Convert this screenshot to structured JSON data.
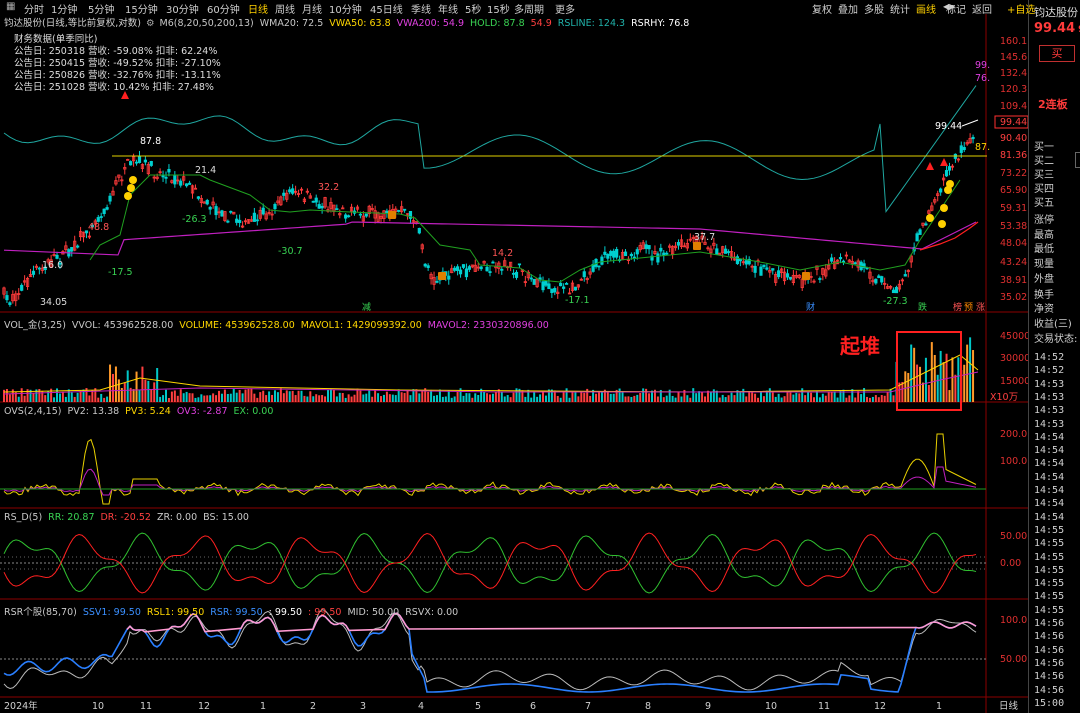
{
  "toolbar": {
    "periods": [
      "分时",
      "1分钟",
      "5分钟",
      "15分钟",
      "30分钟",
      "60分钟",
      "日线",
      "周线",
      "月线",
      "10分钟",
      "45日线",
      "季线",
      "年线",
      "5秒",
      "15秒",
      "多周期",
      "更多"
    ],
    "active_period": "日线",
    "right_buttons": [
      "复权",
      "叠加",
      "多股",
      "统计",
      "画线",
      "标记",
      "返回"
    ],
    "active_right": "画线"
  },
  "main": {
    "stock_title": "钧达股份(日线,等比前复权,对数)",
    "legend": [
      {
        "text": "M6(8,20,50,200,13)",
        "color": "#c8c8c8"
      },
      {
        "text": "WMA20: 72.5",
        "color": "#c8c8c8"
      },
      {
        "text": "VWA50: 63.8",
        "color": "#ffd700"
      },
      {
        "text": "VWA200: 54.9",
        "color": "#e040e0"
      },
      {
        "text": "HOLD: 87.8",
        "color": "#39d353"
      },
      {
        "text": "54.9",
        "color": "#ff4040"
      },
      {
        "text": "RSLINE: 124.3",
        "color": "#20b2aa"
      },
      {
        "text": "RSRHY: 76.8",
        "color": "#ffffff"
      }
    ],
    "finance_title": "财务数据(单季同比)",
    "finance_rows": [
      "公告日: 250318  营收: -59.08%  扣非: 62.24%",
      "公告日: 250415  营收: -49.52%  扣非: -27.10%",
      "公告日: 250826  营收: -32.76%  扣非: -13.11%",
      "公告日: 251028  营收: 10.42%  扣非: 27.48%"
    ],
    "price_labels": [
      "87.8",
      "21.4",
      "-26.3",
      "32.2",
      "-30.7",
      "48.8",
      "16.0",
      "-17.5",
      "34.05",
      "14.2",
      "-17.1",
      "37.7",
      "-27.3",
      "99.44",
      "87.",
      "99.",
      "76."
    ],
    "axis": [
      "160.1",
      "145.6",
      "132.4",
      "120.3",
      "109.4",
      "99.44",
      "90.40",
      "81.36",
      "73.22",
      "65.90",
      "59.31",
      "53.38",
      "48.04",
      "43.24",
      "38.91",
      "35.02"
    ],
    "markers": [
      "减",
      "财",
      "跌",
      "榜",
      "预",
      "涨"
    ]
  },
  "volume": {
    "legend": [
      {
        "text": "VOL_金(3,25)",
        "color": "#c8c8c8"
      },
      {
        "text": "VVOL: 453962528.00",
        "color": "#c8c8c8"
      },
      {
        "text": "VOLUME: 453962528.00",
        "color": "#ffd700"
      },
      {
        "text": "MAVOL1: 1429099392.00",
        "color": "#ffd700"
      },
      {
        "text": "MAVOL2: 2330320896.00",
        "color": "#e040e0"
      }
    ],
    "annotation": "起堆",
    "axis": [
      "45000",
      "30000",
      "15000"
    ],
    "unit": "X10万"
  },
  "ovs": {
    "legend": [
      {
        "text": "OVS(2,4,15)",
        "color": "#c8c8c8"
      },
      {
        "text": "PV2: 13.38",
        "color": "#c8c8c8"
      },
      {
        "text": "PV3: 5.24",
        "color": "#ffd700"
      },
      {
        "text": "OV3: -2.87",
        "color": "#e040e0"
      },
      {
        "text": "EX: 0.00",
        "color": "#39d353"
      }
    ],
    "axis": [
      "200.0",
      "100.0"
    ]
  },
  "rsd": {
    "legend": [
      {
        "text": "RS_D(5)",
        "color": "#c8c8c8"
      },
      {
        "text": "RR: 20.87",
        "color": "#39d353"
      },
      {
        "text": "DR: -20.52",
        "color": "#ff4040"
      },
      {
        "text": "ZR: 0.00",
        "color": "#c8c8c8"
      },
      {
        "text": "BS: 15.00",
        "color": "#c8c8c8"
      }
    ],
    "axis": [
      "50.00",
      "0.00"
    ]
  },
  "rsr": {
    "legend": [
      {
        "text": "RSR个股(85,70)",
        "color": "#c8c8c8"
      },
      {
        "text": "SSV1: 99.50",
        "color": "#3a8fff"
      },
      {
        "text": "RSL1: 99.50",
        "color": "#ffd700"
      },
      {
        "text": "RSR: 99.50",
        "color": "#3a8fff"
      },
      {
        "text": ": 99.50",
        "color": "#ffffff"
      },
      {
        "text": ": 99.50",
        "color": "#ff4040"
      },
      {
        "text": "MID: 50.00",
        "color": "#c8c8c8"
      },
      {
        "text": "RSVX: 0.00",
        "color": "#c8c8c8"
      }
    ],
    "axis": [
      "100.0",
      "50.00"
    ]
  },
  "x_axis": [
    "2024年",
    "10",
    "11",
    "12",
    "1",
    "2",
    "3",
    "4",
    "5",
    "6",
    "7",
    "8",
    "9",
    "10",
    "11",
    "12",
    "1"
  ],
  "x_axis_right": "日线",
  "sidebar": {
    "add_watch": "+自选",
    "stock_name": "钧达股份",
    "price": "99.44",
    "price_cut": "9",
    "buy_btn": "买",
    "board": "2连板",
    "order_rows": [
      "买一",
      "买二",
      "买三",
      "买四",
      "买五"
    ],
    "stat_rows": [
      "涨停",
      "最高",
      "最低",
      "现量",
      "外盘",
      "换手",
      "净资",
      "收益(三)",
      "交易状态:"
    ],
    "times": [
      "14:52",
      "14:52",
      "14:53",
      "14:53",
      "14:53",
      "14:53",
      "14:54",
      "14:54",
      "14:54",
      "14:54",
      "14:54",
      "14:54",
      "14:54",
      "14:55",
      "14:55",
      "14:55",
      "14:55",
      "14:55",
      "14:55",
      "14:55",
      "14:56",
      "14:56",
      "14:56",
      "14:56",
      "14:56",
      "14:56",
      "15:00"
    ]
  }
}
